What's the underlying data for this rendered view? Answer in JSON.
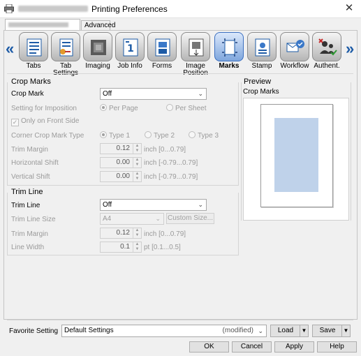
{
  "window": {
    "title": "Printing Preferences",
    "close_glyph": "✕"
  },
  "tabs": [
    {
      "label": ""
    },
    {
      "label": "Advanced"
    }
  ],
  "nav": {
    "left_arrow": "«",
    "right_arrow": "»"
  },
  "icons": [
    {
      "label": "Tabs",
      "icon": "tabs-icon"
    },
    {
      "label": "Tab Settings",
      "icon": "tab-settings-icon"
    },
    {
      "label": "Imaging",
      "icon": "imaging-icon"
    },
    {
      "label": "Job Info",
      "icon": "job-info-icon"
    },
    {
      "label": "Forms",
      "icon": "forms-icon"
    },
    {
      "label": "Image Position",
      "icon": "image-position-icon"
    },
    {
      "label": "Marks",
      "icon": "marks-icon",
      "selected": true
    },
    {
      "label": "Stamp",
      "icon": "stamp-icon"
    },
    {
      "label": "Workflow",
      "icon": "workflow-icon"
    },
    {
      "label": "Authent.",
      "icon": "authentication-icon"
    }
  ],
  "crop_marks": {
    "title": "Crop Marks",
    "crop_mark_label": "Crop Mark",
    "crop_mark_value": "Off",
    "imposition_label": "Setting for Imposition",
    "per_page": "Per Page",
    "per_sheet": "Per Sheet",
    "front_side": "Only on Front Side",
    "corner_type_label": "Corner Crop Mark Type",
    "type1": "Type 1",
    "type2": "Type 2",
    "type3": "Type 3",
    "trim_margin_label": "Trim Margin",
    "trim_margin_value": "0.12",
    "trim_margin_unit": "inch [0...0.79]",
    "h_shift_label": "Horizontal Shift",
    "h_shift_value": "0.00",
    "h_shift_unit": "inch [-0.79...0.79]",
    "v_shift_label": "Vertical Shift",
    "v_shift_value": "0.00",
    "v_shift_unit": "inch [-0.79...0.79]"
  },
  "trim_line": {
    "title": "Trim Line",
    "trim_line_label": "Trim Line",
    "trim_line_value": "Off",
    "size_label": "Trim Line Size",
    "size_value": "A4",
    "custom_size": "Custom Size...",
    "margin_label": "Trim Margin",
    "margin_value": "0.12",
    "margin_unit": "inch [0...0.79]",
    "width_label": "Line Width",
    "width_value": "0.1",
    "width_unit": "pt [0.1...0.5]"
  },
  "preview": {
    "title": "Preview",
    "subtitle": "Crop Marks"
  },
  "favorite": {
    "label": "Favorite Setting",
    "value": "Default Settings",
    "modified": "(modified)",
    "load": "Load",
    "save": "Save"
  },
  "footer": {
    "ok": "OK",
    "cancel": "Cancel",
    "apply": "Apply",
    "help": "Help"
  }
}
